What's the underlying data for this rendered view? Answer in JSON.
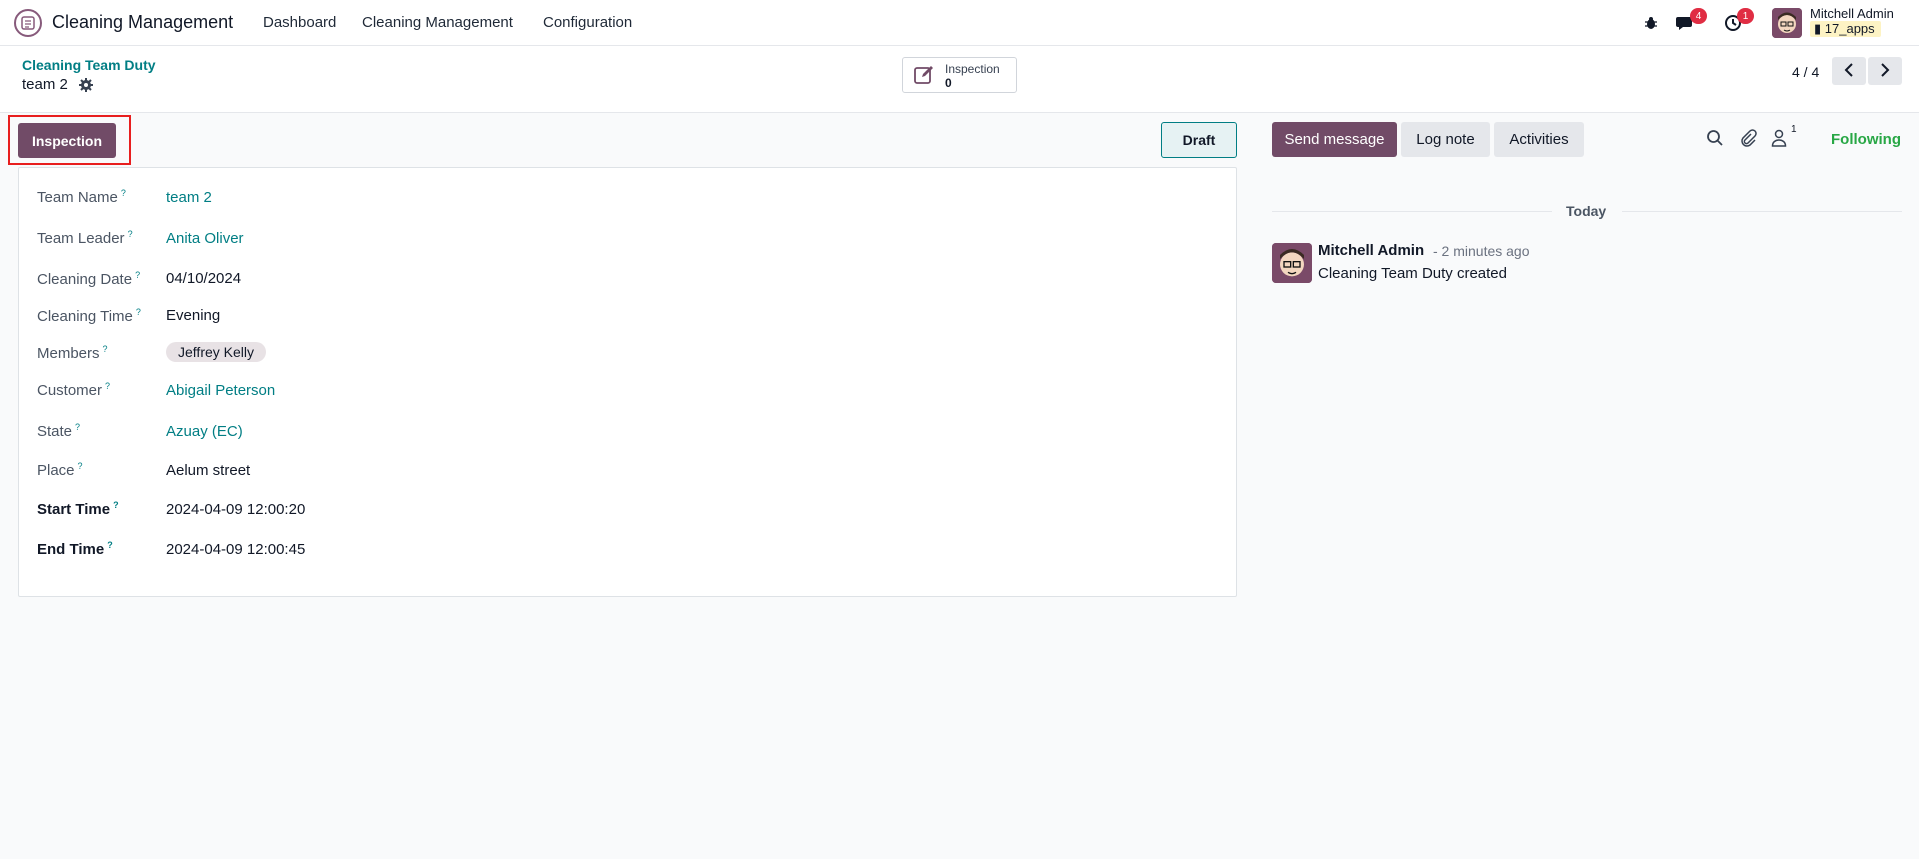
{
  "navbar": {
    "app_name": "Cleaning Management",
    "menu": [
      "Dashboard",
      "Cleaning Management",
      "Configuration"
    ],
    "messages_count": "4",
    "activities_count": "1",
    "user_name": "Mitchell Admin",
    "database": "17_apps"
  },
  "control_panel": {
    "breadcrumb_parent": "Cleaning Team Duty",
    "breadcrumb_current": "team 2",
    "smart_button_label": "Inspection",
    "smart_button_count": "0",
    "pager": "4 / 4"
  },
  "statusbar": {
    "action_button": "Inspection",
    "status": "Draft"
  },
  "form": {
    "fields": [
      {
        "label": "Team Name",
        "value": "team 2"
      },
      {
        "label": "Team Leader",
        "value": "Anita Oliver"
      },
      {
        "label": "Cleaning Date",
        "value": "04/10/2024"
      },
      {
        "label": "Cleaning Time",
        "value": "Evening"
      },
      {
        "label": "Members",
        "value": "Jeffrey Kelly"
      },
      {
        "label": "Customer",
        "value": "Abigail Peterson"
      },
      {
        "label": "State",
        "value": "Azuay (EC)"
      },
      {
        "label": "Place",
        "value": "Aelum street"
      },
      {
        "label": "Start Time",
        "value": "2024-04-09 12:00:20"
      },
      {
        "label": "End Time",
        "value": "2024-04-09 12:00:45"
      }
    ],
    "help_marker": "?"
  },
  "chatter": {
    "send_message": "Send message",
    "log_note": "Log note",
    "activities": "Activities",
    "followers_count": "1",
    "following": "Following",
    "date_separator": "Today",
    "message": {
      "author": "Mitchell Admin",
      "time": "- 2 minutes ago",
      "body": "Cleaning Team Duty created"
    }
  },
  "colors": {
    "brand": "#714b67",
    "link": "#017e84",
    "following": "#28a745",
    "badge": "#e02d43",
    "highlight": "#e81e1e"
  },
  "icons": [
    "app-logo-icon",
    "bug-icon",
    "chat-icon",
    "clock-icon",
    "database-icon",
    "gear-icon",
    "edit-icon",
    "chevron-left-icon",
    "chevron-right-icon",
    "search-icon",
    "paperclip-icon",
    "user-icon"
  ]
}
